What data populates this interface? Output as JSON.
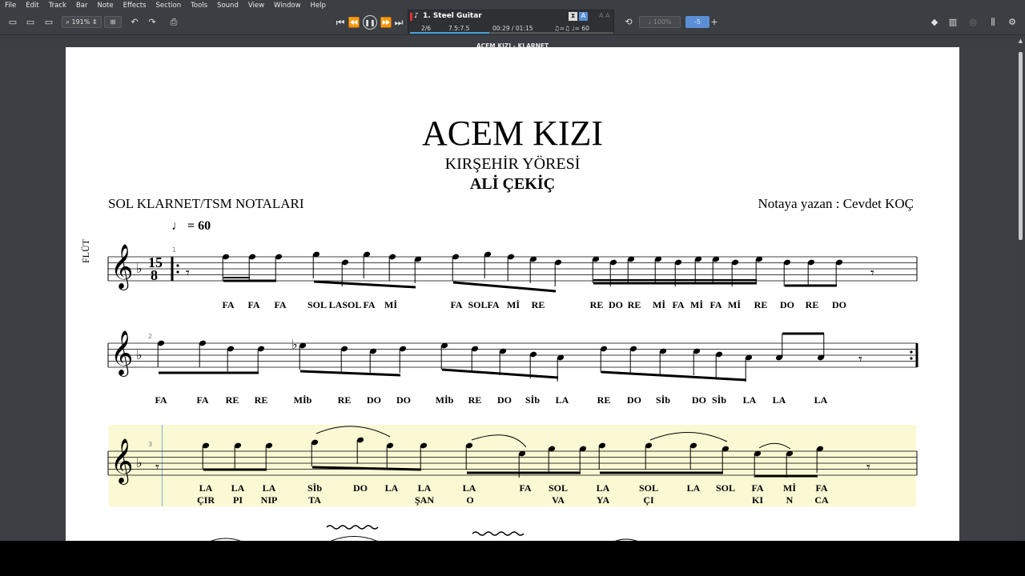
{
  "menu": [
    "File",
    "Edit",
    "Track",
    "Bar",
    "Note",
    "Effects",
    "Section",
    "Tools",
    "Sound",
    "View",
    "Window",
    "Help"
  ],
  "toolbar": {
    "zoom": "191%",
    "track_name": "1. Steel Guitar",
    "position": "2/6",
    "measure": "7.5:7.5",
    "time": "00:29 / 01:15",
    "tempo": "♫=♫ ♩= 60",
    "zoom_pct": "100%",
    "transpose": "-5",
    "progress": 0.39
  },
  "document_tab": "ACEM KIZI - KLARNET",
  "score": {
    "title": "ACEM KIZI",
    "subtitle": "KIRŞEHİR YÖRESİ",
    "author": "ALİ ÇEKİÇ",
    "left_info": "SOL KLARNET/TSM NOTALARI",
    "right_info": "Notaya yazan : Cevdet KOÇ",
    "tempo_text": "= 60",
    "instrument": "FLÜT",
    "time_sig_top": "15",
    "time_sig_bottom": "8",
    "system1_number": "1",
    "system2_number": "2",
    "system3_number": "3",
    "system1_lyrics": [
      "FA",
      "FA",
      "FA",
      "SOL",
      "LASOL",
      "FA",
      "Mİ",
      "FA",
      "SOLFA",
      "Mİ",
      "RE",
      "RE",
      "DO",
      "RE",
      "Mİ",
      "FA",
      "Mİ",
      "FA",
      "Mİ",
      "RE",
      "DO",
      "RE",
      "DO"
    ],
    "system2_lyrics": [
      "FA",
      "FA",
      "RE",
      "RE",
      "Mİb",
      "RE",
      "DO",
      "DO",
      "Mİb",
      "RE",
      "DO",
      "Sİb",
      "LA",
      "RE",
      "DO",
      "Sİb",
      "DO",
      "Sİb",
      "LA",
      "LA",
      "LA"
    ],
    "system3_lyrics": [
      "LA",
      "LA",
      "LA",
      "Sİb",
      "DO",
      "LA",
      "LA",
      "LA",
      "FA",
      "SOL",
      "LA",
      "SOL",
      "LA",
      "SOL",
      "FA",
      "Mİ",
      "FA"
    ],
    "system3_words": [
      "ÇIR",
      "PI",
      "NIP",
      "TA",
      "ŞAN",
      "O",
      "VA",
      "YA",
      "ÇI",
      "KI",
      "N",
      "CA"
    ]
  }
}
